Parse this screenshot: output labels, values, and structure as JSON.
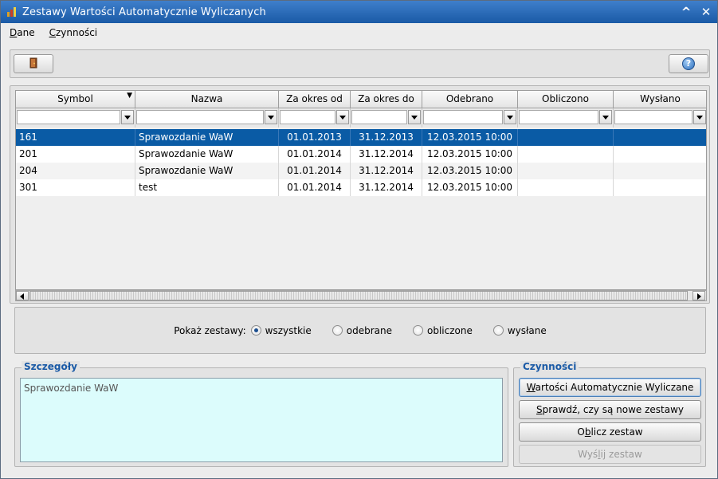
{
  "window": {
    "title": "Zestawy Wartości Automatycznie Wyliczanych",
    "minimize_glyph": "^",
    "close_glyph": "✕"
  },
  "menu": [
    {
      "label_first": "D",
      "label_rest": "ane"
    },
    {
      "label_first": "C",
      "label_rest": "zynności"
    }
  ],
  "toolbar": {
    "exit_icon": "door-exit-icon",
    "help_icon": "help-icon",
    "help_glyph": "?"
  },
  "grid": {
    "columns": [
      "Symbol",
      "Nazwa",
      "Za okres od",
      "Za okres do",
      "Odebrano",
      "Obliczono",
      "Wysłano"
    ],
    "sort_indicator": "▼",
    "rows": [
      {
        "symbol": "161",
        "nazwa": "Sprawozdanie WaW",
        "od": "01.01.2013",
        "do": "31.12.2013",
        "odebrano": "12.03.2015 10:00",
        "obliczono": "",
        "wyslano": "",
        "selected": true
      },
      {
        "symbol": "201",
        "nazwa": "Sprawozdanie WaW",
        "od": "01.01.2014",
        "do": "31.12.2014",
        "odebrano": "12.03.2015 10:00",
        "obliczono": "",
        "wyslano": "",
        "selected": false
      },
      {
        "symbol": "204",
        "nazwa": "Sprawozdanie WaW",
        "od": "01.01.2014",
        "do": "31.12.2014",
        "odebrano": "12.03.2015 10:00",
        "obliczono": "",
        "wyslano": "",
        "selected": false
      },
      {
        "symbol": "301",
        "nazwa": "test",
        "od": "01.01.2014",
        "do": "31.12.2014",
        "odebrano": "12.03.2015 10:00",
        "obliczono": "",
        "wyslano": "",
        "selected": false
      }
    ]
  },
  "filter": {
    "label": "Pokaż zestawy:",
    "options": [
      "wszystkie",
      "odebrane",
      "obliczone",
      "wysłane"
    ],
    "selected": "wszystkie"
  },
  "details": {
    "title": "Szczegóły",
    "text": "Sprawozdanie WaW"
  },
  "actions": {
    "title": "Czynności",
    "buttons": [
      {
        "first": "W",
        "rest": "artości Automatycznie Wyliczane"
      },
      {
        "first": "S",
        "rest": "prawdź, czy są nowe zestawy"
      },
      {
        "pre": "O",
        "first": "b",
        "rest": "licz zestaw"
      },
      {
        "pre": "Wyś",
        "first": "l",
        "rest": "ij zestaw"
      }
    ]
  },
  "colors": {
    "title_bar": "#1a5aa6",
    "selection": "#0a5ba5",
    "details_bg": "#dcfcfc",
    "group_title": "#1a5aa6"
  }
}
